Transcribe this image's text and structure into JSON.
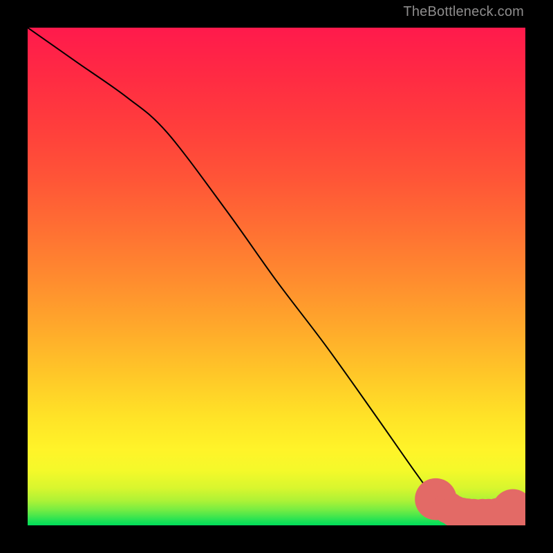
{
  "attribution": "TheBottleneck.com",
  "chart_data": {
    "type": "line",
    "title": "",
    "xlabel": "",
    "ylabel": "",
    "xlim": [
      0,
      100
    ],
    "ylim": [
      0,
      114
    ],
    "gradient_stops": [
      {
        "pos": 0.0,
        "color": "#00de5a"
      },
      {
        "pos": 0.01,
        "color": "#21e254"
      },
      {
        "pos": 0.02,
        "color": "#4ce74b"
      },
      {
        "pos": 0.032,
        "color": "#79ed42"
      },
      {
        "pos": 0.05,
        "color": "#aef236"
      },
      {
        "pos": 0.075,
        "color": "#d8f62e"
      },
      {
        "pos": 0.11,
        "color": "#f4f92a"
      },
      {
        "pos": 0.15,
        "color": "#fff429"
      },
      {
        "pos": 0.22,
        "color": "#ffe227"
      },
      {
        "pos": 0.3,
        "color": "#ffc828"
      },
      {
        "pos": 0.4,
        "color": "#ffa82b"
      },
      {
        "pos": 0.5,
        "color": "#ff8a2f"
      },
      {
        "pos": 0.6,
        "color": "#ff6e33"
      },
      {
        "pos": 0.7,
        "color": "#ff5437"
      },
      {
        "pos": 0.8,
        "color": "#ff3e3c"
      },
      {
        "pos": 0.9,
        "color": "#ff2b43"
      },
      {
        "pos": 1.0,
        "color": "#ff1a4c"
      }
    ],
    "series": [
      {
        "name": "bottleneck-curve",
        "color": "#000000",
        "width": 2,
        "x": [
          0,
          10,
          20,
          28,
          40,
          50,
          60,
          70,
          78,
          82,
          86,
          90,
          94,
          98,
          100
        ],
        "y": [
          114,
          106,
          98,
          90,
          72,
          56,
          41,
          25,
          12,
          6,
          2,
          0,
          0,
          2,
          4
        ]
      }
    ],
    "markers": {
      "name": "highlight-region",
      "color": "#e36a66",
      "radius_end": 4.2,
      "radius_mid": 3.2,
      "points": [
        {
          "x": 82.0,
          "y": 6.0,
          "r": "end"
        },
        {
          "x": 83.3,
          "y": 4.9,
          "r": "mid"
        },
        {
          "x": 84.6,
          "y": 4.0,
          "r": "mid"
        },
        {
          "x": 85.8,
          "y": 3.2,
          "r": "mid"
        },
        {
          "x": 87.2,
          "y": 2.7,
          "r": "mid"
        },
        {
          "x": 88.4,
          "y": 2.5,
          "r": "mid"
        },
        {
          "x": 89.6,
          "y": 2.4,
          "r": "mid"
        },
        {
          "x": 91.4,
          "y": 2.4,
          "r": "mid"
        },
        {
          "x": 92.6,
          "y": 2.4,
          "r": "mid"
        },
        {
          "x": 94.4,
          "y": 2.6,
          "r": "mid"
        },
        {
          "x": 95.6,
          "y": 2.9,
          "r": "mid"
        },
        {
          "x": 97.5,
          "y": 3.5,
          "r": "end"
        }
      ]
    }
  }
}
